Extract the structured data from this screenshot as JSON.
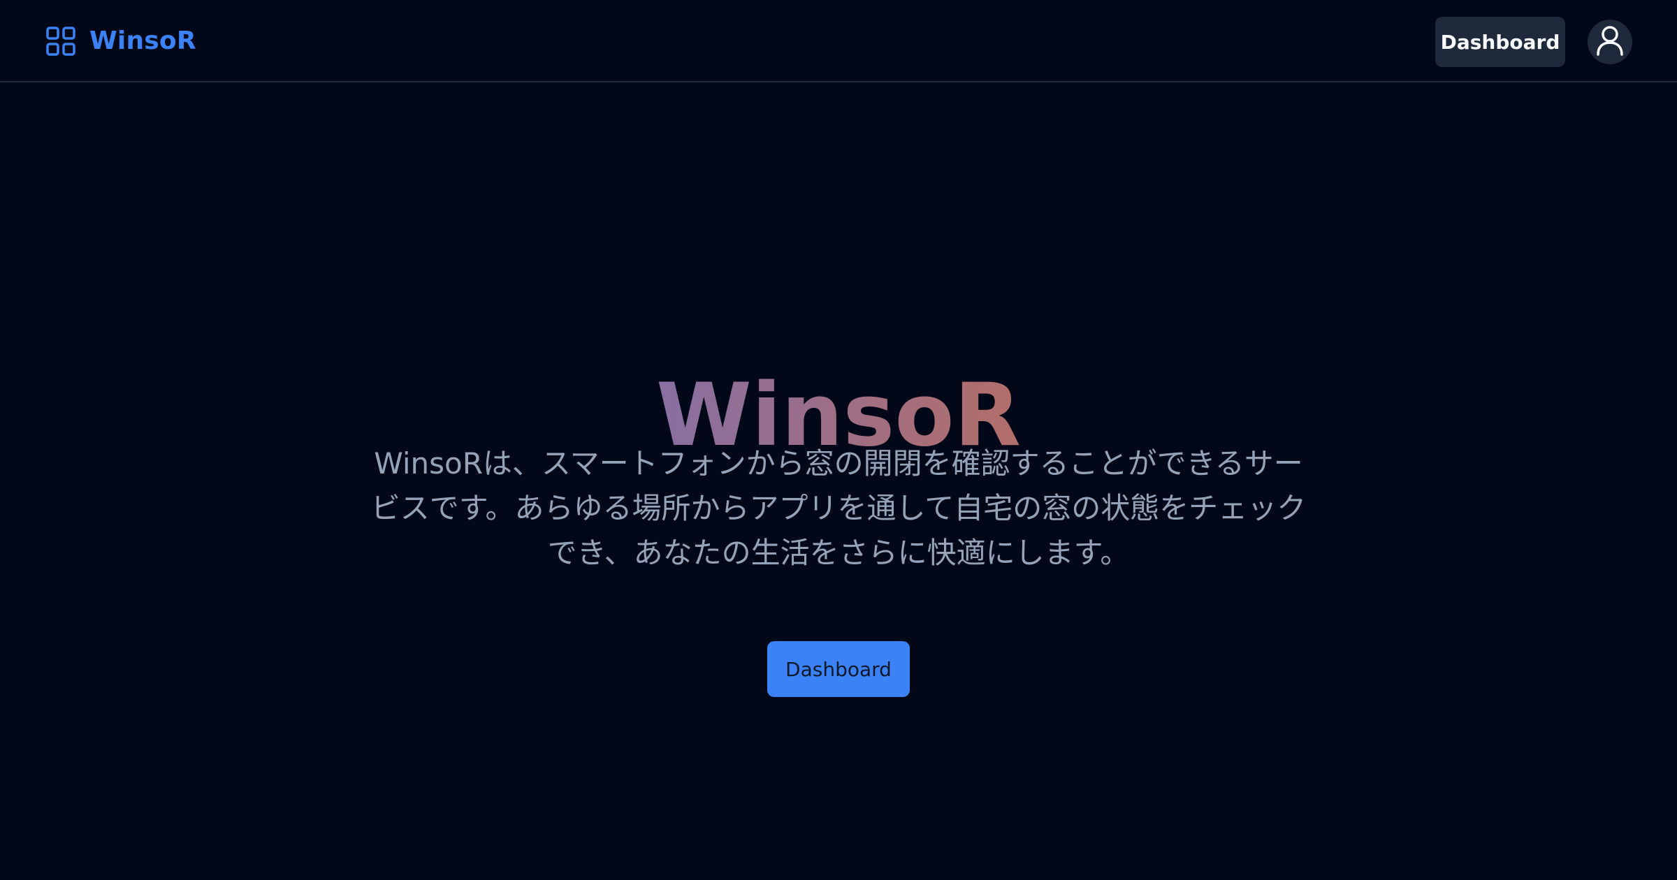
{
  "header": {
    "brand_name": "WinsoR",
    "brand_icon": "grid-icon",
    "dashboard_label": "Dashboard",
    "avatar_icon": "user-icon"
  },
  "hero": {
    "title": "WinsoR",
    "description": "WinsoRは、スマートフォンから窓の開閉を確認することができるサービスです。あらゆる場所からアプリを通して自宅の窓の状態をチェックでき、あなたの生活をさらに快適にします。",
    "button_label": "Dashboard"
  },
  "colors": {
    "background": "#020817",
    "accent": "#3b82f6",
    "muted_text": "#94a3b8",
    "header_border": "#1e293b",
    "title_gradient_start": "#5b71d4",
    "title_gradient_end": "#e66a2c"
  }
}
